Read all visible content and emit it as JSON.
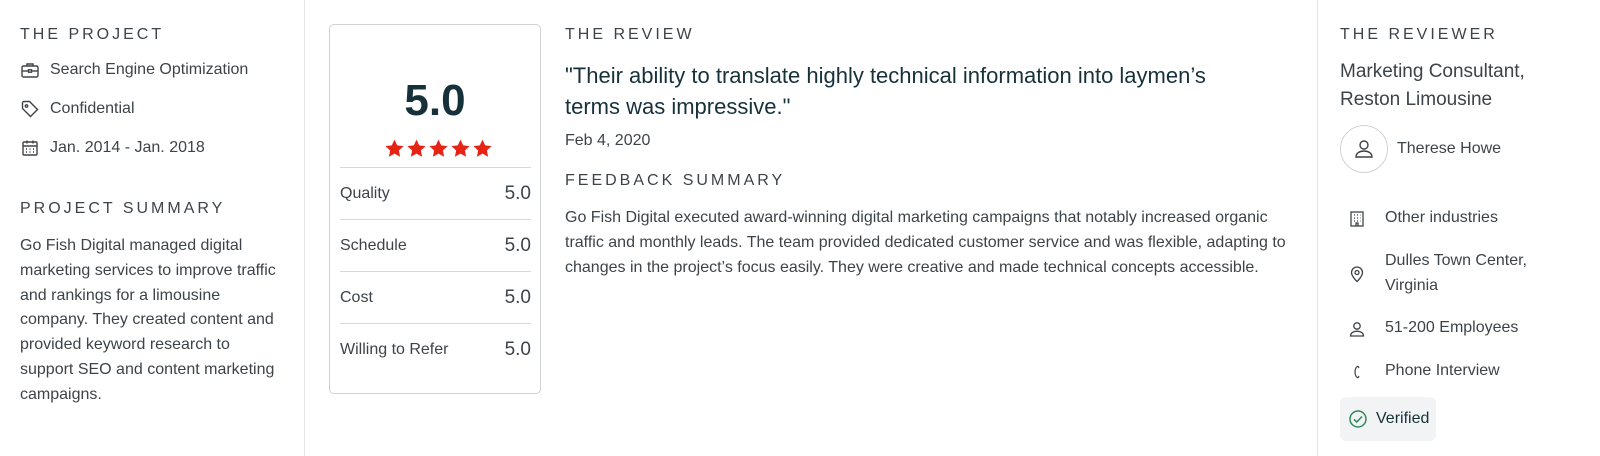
{
  "project": {
    "section_title": "THE PROJECT",
    "service": "Search Engine Optimization",
    "budget": "Confidential",
    "dates": "Jan. 2014 - Jan. 2018",
    "summary_title": "PROJECT SUMMARY",
    "summary": "Go Fish Digital managed digital marketing services to improve traffic and rankings for a limousine company. They created content and provided keyword research to support SEO and content marketing campaigns."
  },
  "rating": {
    "overall": "5.0",
    "stars": 5,
    "star_color": "#e62415",
    "rows": [
      {
        "label": "Quality",
        "value": "5.0"
      },
      {
        "label": "Schedule",
        "value": "5.0"
      },
      {
        "label": "Cost",
        "value": "5.0"
      },
      {
        "label": "Willing to Refer",
        "value": "5.0"
      }
    ]
  },
  "review": {
    "section_title": "THE REVIEW",
    "quote": "\"Their ability to translate highly technical information into laymen’s terms was impressive.\"",
    "date": "Feb 4, 2020",
    "feedback_title": "FEEDBACK SUMMARY",
    "feedback": "Go Fish Digital executed award-winning digital marketing campaigns that notably increased organic traffic and monthly leads. The team provided dedicated customer service and was flexible, adapting to changes in the project’s focus easily. They were creative and made technical concepts accessible."
  },
  "reviewer": {
    "section_title": "THE REVIEWER",
    "title": "Marketing Consultant, Reston Limousine",
    "name": "Therese Howe",
    "industry": "Other industries",
    "location": "Dulles Town Center, Virginia",
    "employees": "51-200 Employees",
    "interview": "Phone Interview",
    "verified": "Verified",
    "verified_color": "#2e8b57"
  },
  "icons": {
    "service": "briefcase-icon",
    "budget": "tag-icon",
    "dates": "calendar-icon",
    "person": "person-icon",
    "industry": "building-icon",
    "location": "map-pin-icon",
    "employees": "person-icon",
    "interview": "phone-icon",
    "verified": "check-circle-icon"
  }
}
